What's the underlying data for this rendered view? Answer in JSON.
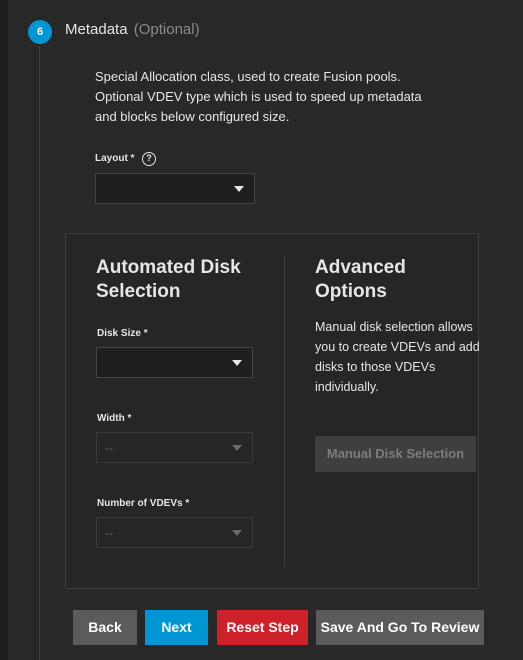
{
  "step": {
    "number": "6",
    "title": "Metadata",
    "optional": "(Optional)"
  },
  "description": "Special Allocation class, used to create Fusion pools. Optional VDEV type which is used to speed up metadata and blocks below configured size.",
  "layout": {
    "label": "Layout *",
    "help_glyph": "?",
    "value": ""
  },
  "automated": {
    "title": "Automated Disk Selection",
    "disk_size": {
      "label": "Disk Size *",
      "value": ""
    },
    "width": {
      "label": "Width *",
      "value": "--"
    },
    "vdevs": {
      "label": "Number of VDEVs *",
      "value": "--"
    }
  },
  "advanced": {
    "title": "Advanced Options",
    "description": "Manual disk selection allows you to create VDEVs and add disks to those VDEVs individually.",
    "manual_button": "Manual Disk Selection"
  },
  "actions": {
    "back": "Back",
    "next": "Next",
    "reset": "Reset Step",
    "review": "Save And Go To Review"
  },
  "colors": {
    "accent": "#0095d5",
    "danger": "#ce2129",
    "neutral_button": "#5b5b5b"
  }
}
